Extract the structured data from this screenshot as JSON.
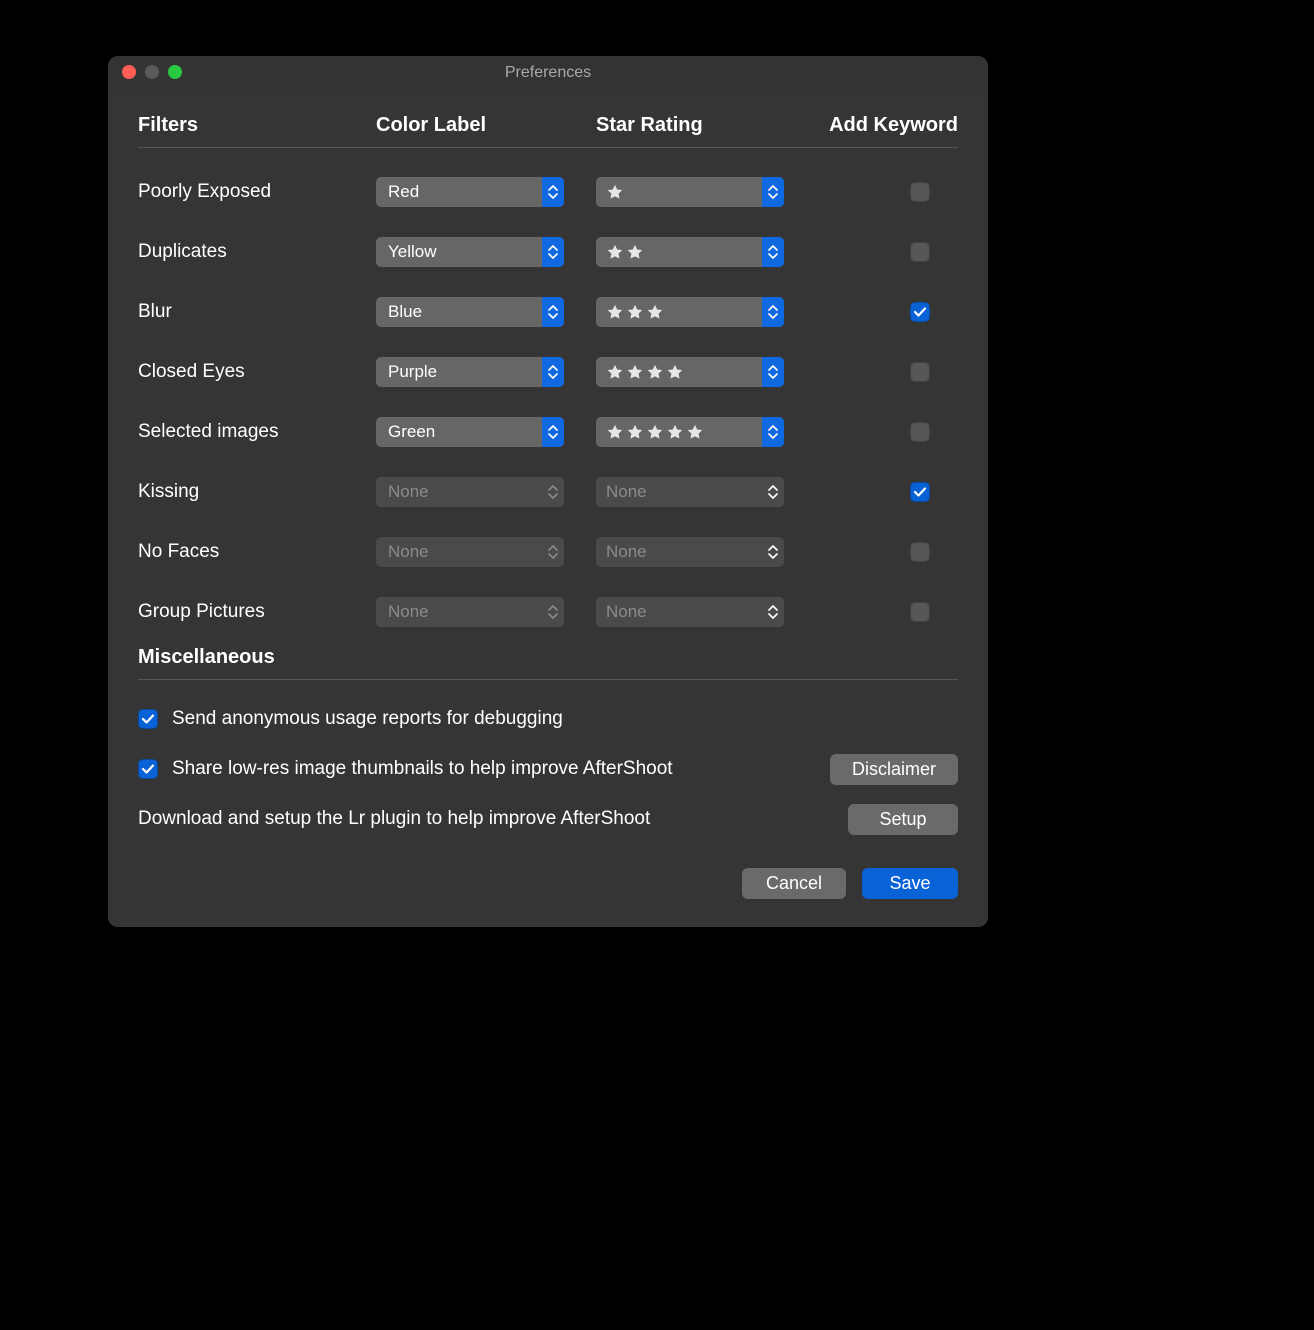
{
  "window": {
    "title": "Preferences"
  },
  "headers": {
    "filters": "Filters",
    "color_label": "Color Label",
    "star_rating": "Star Rating",
    "add_keyword": "Add Keyword"
  },
  "filters": [
    {
      "name": "Poorly Exposed",
      "color_label": "Red",
      "stars": 1,
      "rating_none_label": "None",
      "enabled": true,
      "add_keyword": false
    },
    {
      "name": "Duplicates",
      "color_label": "Yellow",
      "stars": 2,
      "rating_none_label": "None",
      "enabled": true,
      "add_keyword": false
    },
    {
      "name": "Blur",
      "color_label": "Blue",
      "stars": 3,
      "rating_none_label": "None",
      "enabled": true,
      "add_keyword": true
    },
    {
      "name": "Closed Eyes",
      "color_label": "Purple",
      "stars": 4,
      "rating_none_label": "None",
      "enabled": true,
      "add_keyword": false
    },
    {
      "name": "Selected images",
      "color_label": "Green",
      "stars": 5,
      "rating_none_label": "None",
      "enabled": true,
      "add_keyword": false
    },
    {
      "name": "Kissing",
      "color_label": "None",
      "stars": 0,
      "rating_none_label": "None",
      "enabled": false,
      "add_keyword": true
    },
    {
      "name": "No Faces",
      "color_label": "None",
      "stars": 0,
      "rating_none_label": "None",
      "enabled": false,
      "add_keyword": false
    },
    {
      "name": "Group Pictures",
      "color_label": "None",
      "stars": 0,
      "rating_none_label": "None",
      "enabled": false,
      "add_keyword": false
    }
  ],
  "misc": {
    "section_title": "Miscellaneous",
    "anon_reports": {
      "label": "Send anonymous usage reports for debugging",
      "checked": true
    },
    "share_thumbs": {
      "label": "Share low-res image thumbnails to help improve AfterShoot",
      "checked": true,
      "button": "Disclaimer"
    },
    "lr_plugin": {
      "label": "Download and setup the Lr plugin to help improve AfterShoot",
      "button": "Setup"
    }
  },
  "footer": {
    "cancel": "Cancel",
    "save": "Save"
  }
}
